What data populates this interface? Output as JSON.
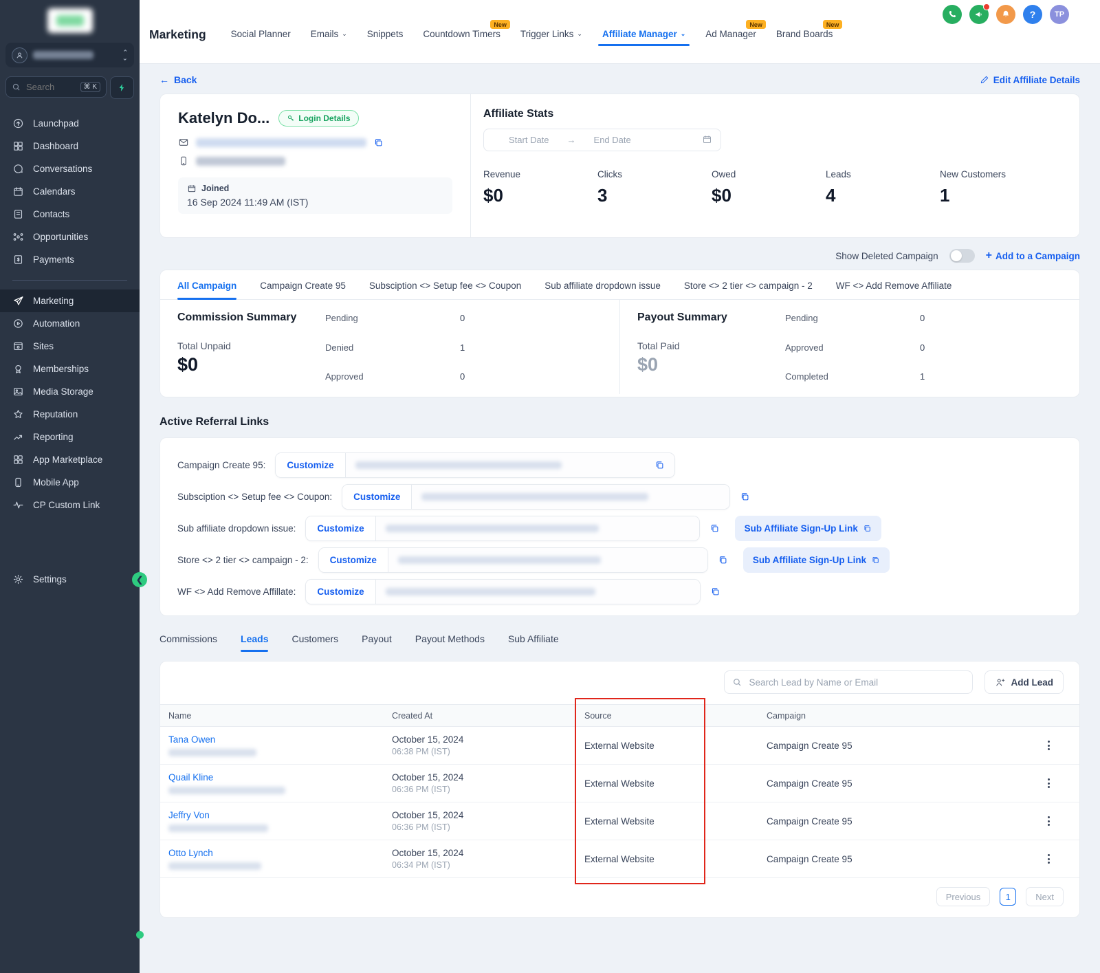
{
  "topbar": {
    "title": "Marketing",
    "tabs": [
      {
        "label": "Social Planner"
      },
      {
        "label": "Emails",
        "chevron": "⌄"
      },
      {
        "label": "Snippets"
      },
      {
        "label": "Countdown Timers",
        "badge": "New"
      },
      {
        "label": "Trigger Links",
        "chevron": "⌄"
      },
      {
        "label": "Affiliate Manager",
        "chevron": "⌄"
      },
      {
        "label": "Ad Manager",
        "badge": "New"
      },
      {
        "label": "Brand Boards",
        "badge": "New"
      }
    ],
    "avatar_initials": "TP"
  },
  "sidebar": {
    "search_placeholder": "Search",
    "shortcut": "⌘ K",
    "items_top": [
      {
        "label": "Launchpad"
      },
      {
        "label": "Dashboard"
      },
      {
        "label": "Conversations"
      },
      {
        "label": "Calendars"
      },
      {
        "label": "Contacts"
      },
      {
        "label": "Opportunities"
      },
      {
        "label": "Payments"
      }
    ],
    "items_bottom": [
      {
        "label": "Marketing"
      },
      {
        "label": "Automation"
      },
      {
        "label": "Sites"
      },
      {
        "label": "Memberships"
      },
      {
        "label": "Media Storage"
      },
      {
        "label": "Reputation"
      },
      {
        "label": "Reporting"
      },
      {
        "label": "App Marketplace"
      },
      {
        "label": "Mobile App"
      },
      {
        "label": "CP Custom Link"
      }
    ],
    "settings_label": "Settings"
  },
  "header": {
    "back_label": "Back",
    "edit_label": "Edit Affiliate Details"
  },
  "affiliate": {
    "name": "Katelyn Do...",
    "login_details_label": "Login Details",
    "joined_label": "Joined",
    "joined_value": "16 Sep 2024 11:49 AM (IST)"
  },
  "stats": {
    "title": "Affiliate Stats",
    "start_placeholder": "Start Date",
    "arrow": "→",
    "end_placeholder": "End Date",
    "metrics": [
      {
        "label": "Revenue",
        "value": "$0"
      },
      {
        "label": "Clicks",
        "value": "3"
      },
      {
        "label": "Owed",
        "value": "$0"
      },
      {
        "label": "Leads",
        "value": "4"
      },
      {
        "label": "New Customers",
        "value": "1"
      }
    ]
  },
  "campaign_bar": {
    "toggle_label": "Show Deleted Campaign",
    "add_label": "Add to a Campaign"
  },
  "campaign_tabs": [
    {
      "label": "All Campaign"
    },
    {
      "label": "Campaign Create 95"
    },
    {
      "label": "Subsciption <> Setup fee <> Coupon"
    },
    {
      "label": "Sub affiliate dropdown issue"
    },
    {
      "label": "Store <> 2 tier <> campaign - 2"
    },
    {
      "label": "WF <> Add Remove Affiliate"
    }
  ],
  "commission_summary": {
    "title": "Commission Summary",
    "total_label": "Total Unpaid",
    "total_value": "$0",
    "rows": [
      {
        "label": "Pending",
        "value": "0"
      },
      {
        "label": "Denied",
        "value": "1"
      },
      {
        "label": "Approved",
        "value": "0"
      }
    ]
  },
  "payout_summary": {
    "title": "Payout Summary",
    "total_label": "Total Paid",
    "total_value": "$0",
    "rows": [
      {
        "label": "Pending",
        "value": "0"
      },
      {
        "label": "Approved",
        "value": "0"
      },
      {
        "label": "Completed",
        "value": "1"
      }
    ]
  },
  "referral": {
    "title": "Active Referral Links",
    "customize_label": "Customize",
    "rows": [
      {
        "label": "Campaign Create 95:"
      },
      {
        "label": "Subsciption <> Setup fee <> Coupon:"
      },
      {
        "label": "Sub affiliate dropdown issue:",
        "signup_label": "Sub Affiliate Sign-Up Link"
      },
      {
        "label": "Store <> 2 tier <> campaign - 2:",
        "signup_label": "Sub Affiliate Sign-Up Link"
      },
      {
        "label": "WF <> Add Remove Affillate:"
      }
    ]
  },
  "leads_tabs": [
    {
      "label": "Commissions"
    },
    {
      "label": "Leads"
    },
    {
      "label": "Customers"
    },
    {
      "label": "Payout"
    },
    {
      "label": "Payout Methods"
    },
    {
      "label": "Sub Affiliate"
    }
  ],
  "leads": {
    "search_placeholder": "Search Lead by Name or Email",
    "add_label": "Add Lead",
    "columns": {
      "name": "Name",
      "created": "Created At",
      "source": "Source",
      "campaign": "Campaign"
    },
    "rows": [
      {
        "name": "Tana Owen",
        "date": "October 15, 2024",
        "time": "06:38 PM (IST)",
        "source": "External Website",
        "campaign": "Campaign Create 95"
      },
      {
        "name": "Quail Kline",
        "date": "October 15, 2024",
        "time": "06:36 PM (IST)",
        "source": "External Website",
        "campaign": "Campaign Create 95"
      },
      {
        "name": "Jeffry Von",
        "date": "October 15, 2024",
        "time": "06:36 PM (IST)",
        "source": "External Website",
        "campaign": "Campaign Create 95"
      },
      {
        "name": "Otto Lynch",
        "date": "October 15, 2024",
        "time": "06:34 PM (IST)",
        "source": "External Website",
        "campaign": "Campaign Create 95"
      }
    ],
    "pagination": {
      "prev": "Previous",
      "page": "1",
      "next": "Next"
    }
  },
  "colors": {
    "accent_blue": "#1570ef",
    "sidebar_bg": "#2b3544",
    "badge_yellow": "#fdb022",
    "annotation_red": "#e0261b",
    "success_green": "#2ecb80"
  }
}
